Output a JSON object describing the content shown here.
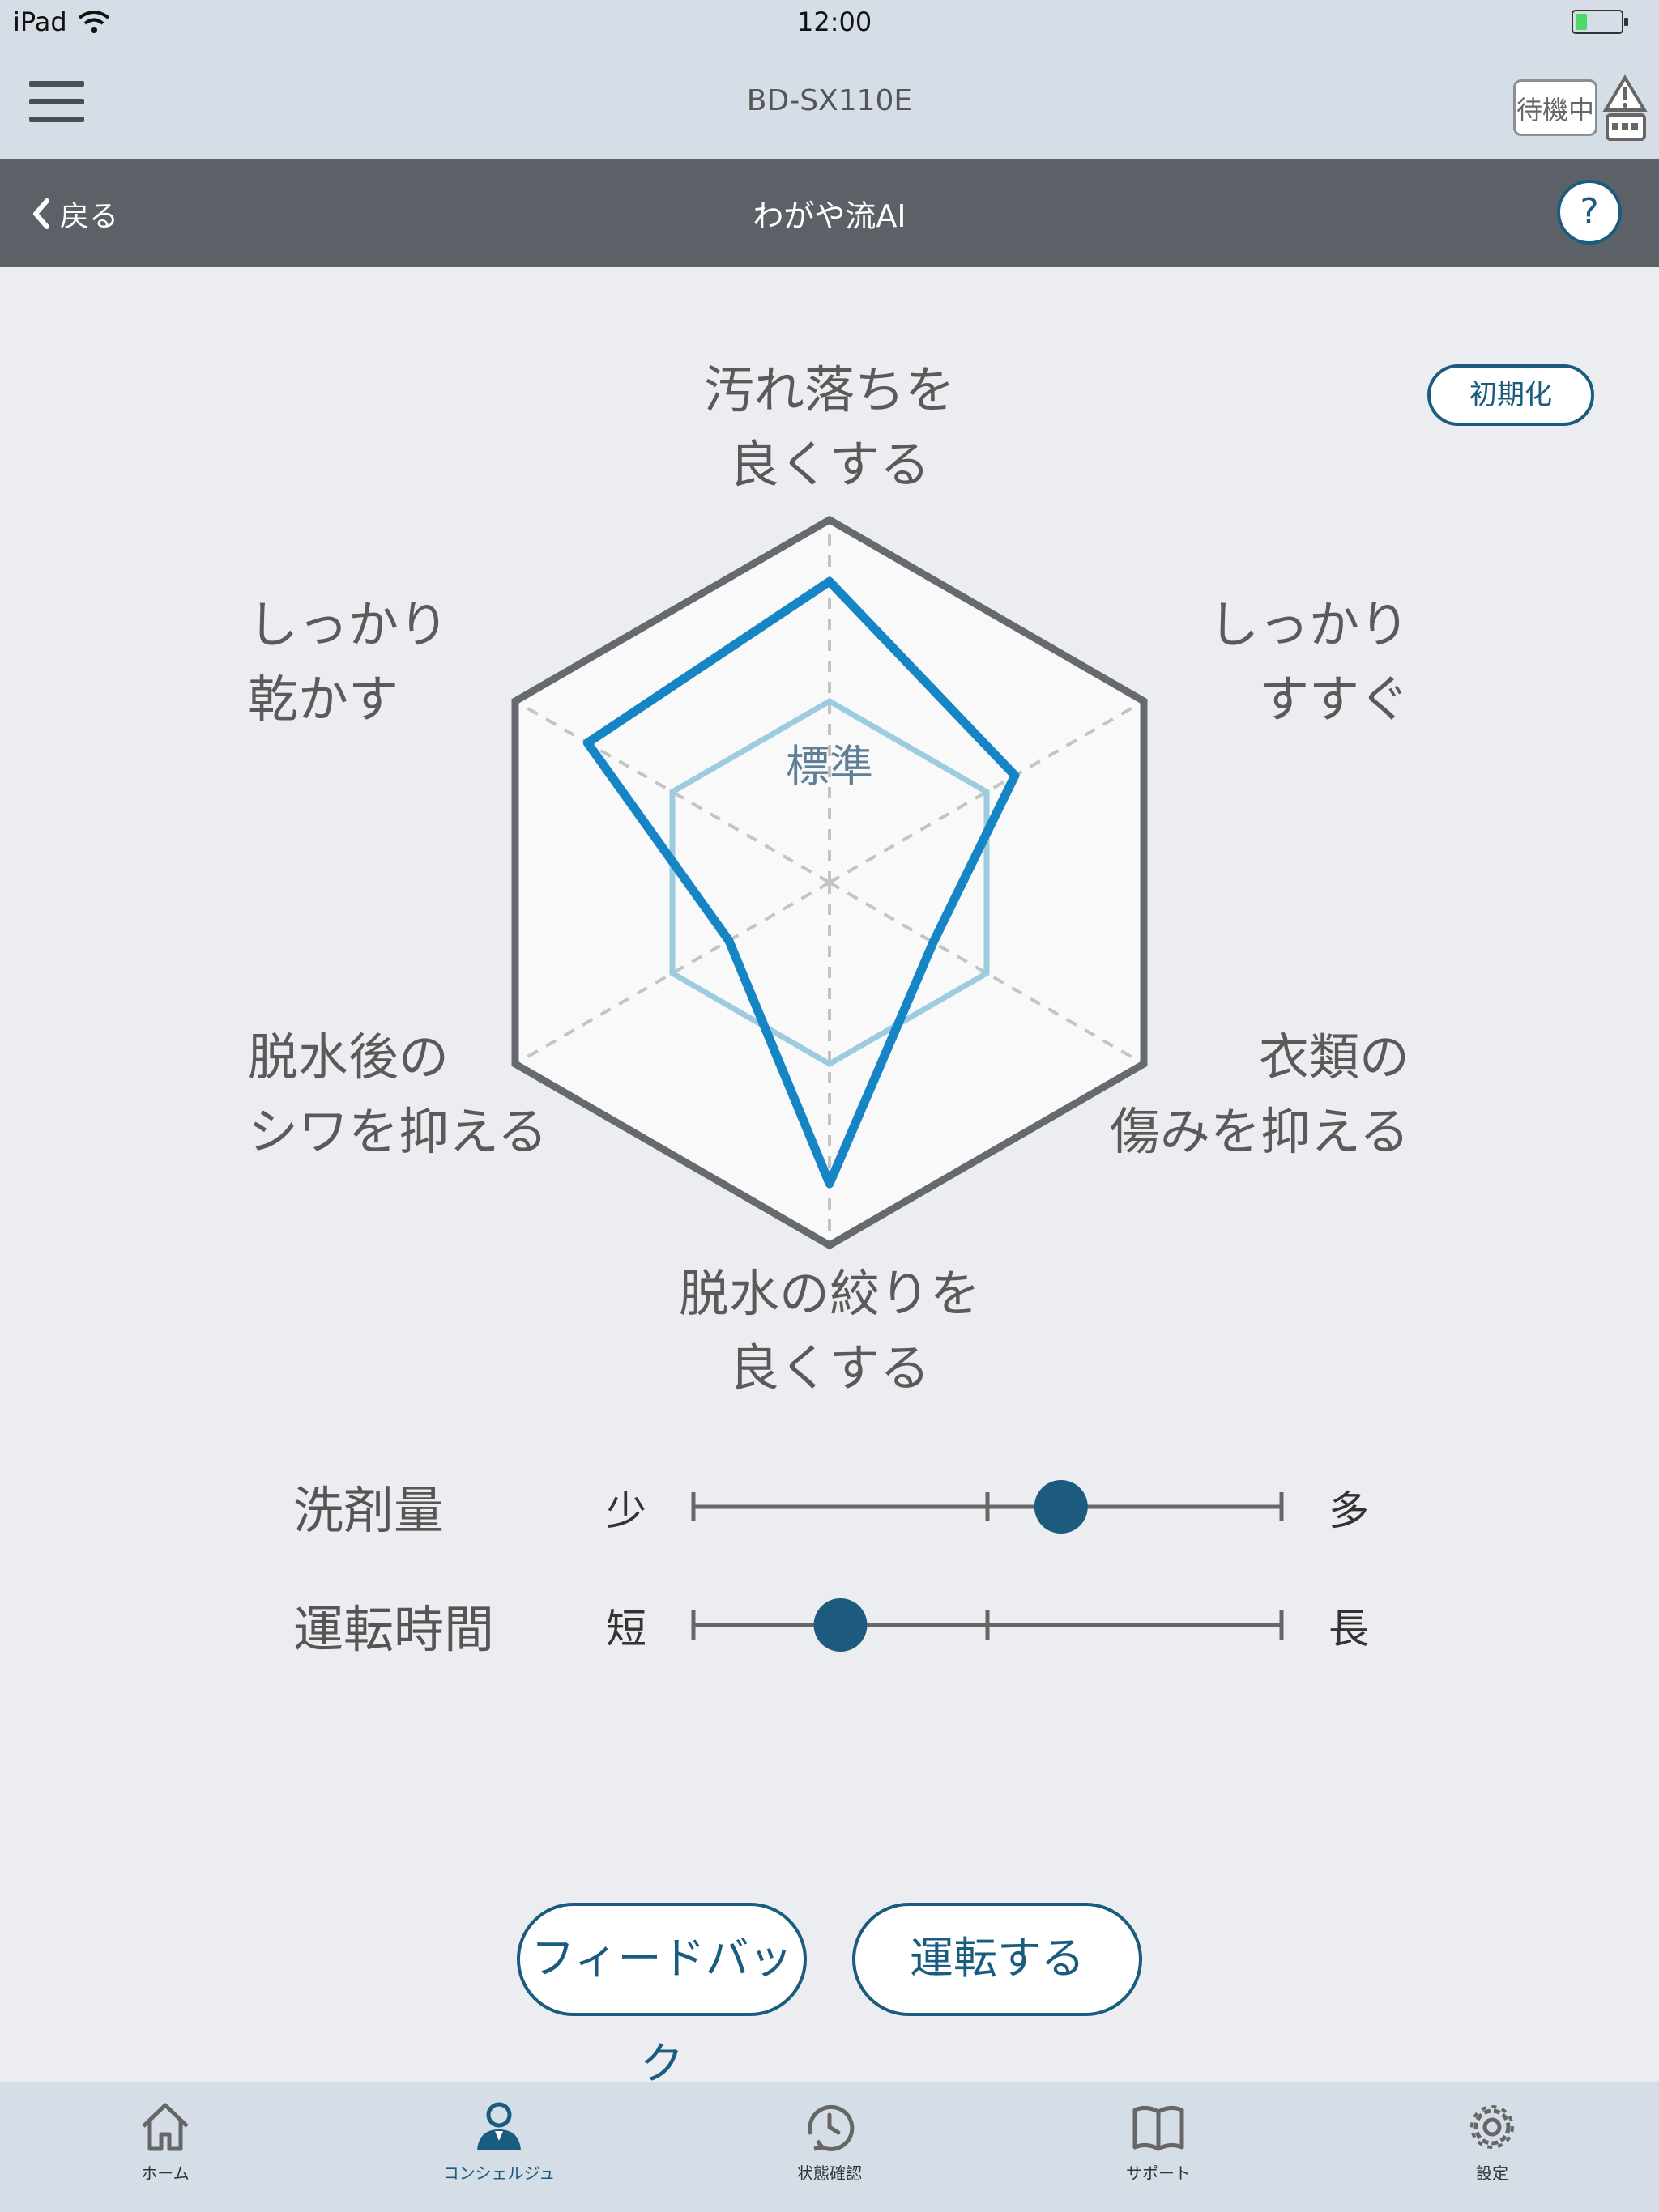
{
  "status_bar": {
    "device": "iPad",
    "time": "12:00"
  },
  "app_header": {
    "model": "BD-SX110E",
    "standby_badge": "待機中"
  },
  "nav": {
    "back_label": "戻る",
    "title": "わがや流AI",
    "help_label": "?"
  },
  "reset_button": "初期化",
  "radar": {
    "center_label": "標準",
    "axes": [
      {
        "id": "dirt",
        "lines": [
          "汚れ落ちを",
          "良くする"
        ],
        "level": 0.83
      },
      {
        "id": "rinse",
        "lines": [
          "しっかり",
          "すすぐ"
        ],
        "level": 0.59
      },
      {
        "id": "fabric",
        "lines": [
          "衣類の",
          "傷みを抑える"
        ],
        "level": 0.33
      },
      {
        "id": "spin",
        "lines": [
          "脱水の絞りを",
          "良くする"
        ],
        "level": 0.83
      },
      {
        "id": "wrinkle",
        "lines": [
          "脱水後の",
          "シワを抑える"
        ],
        "level": 0.32
      },
      {
        "id": "dry",
        "lines": [
          "しっかり",
          "乾かす"
        ],
        "level": 0.77
      }
    ],
    "standard_level": 0.5,
    "colors": {
      "outer": "#666a6e",
      "standard": "#9dcbe0",
      "user": "#1685c6"
    }
  },
  "sliders": [
    {
      "id": "detergent",
      "label": "洗剤量",
      "min_label": "少",
      "max_label": "多",
      "value": 0.625
    },
    {
      "id": "duration",
      "label": "運転時間",
      "min_label": "短",
      "max_label": "長",
      "value": 0.25
    }
  ],
  "buttons": {
    "feedback": "フィードバック",
    "run": "運転する"
  },
  "tabs": [
    {
      "id": "home",
      "label": "ホーム",
      "icon": "home-icon"
    },
    {
      "id": "concierge",
      "label": "コンシェルジュ",
      "icon": "concierge-icon",
      "active": true
    },
    {
      "id": "status",
      "label": "状態確認",
      "icon": "clock-icon"
    },
    {
      "id": "support",
      "label": "サポート",
      "icon": "book-icon"
    },
    {
      "id": "settings",
      "label": "設定",
      "icon": "gear-icon"
    }
  ],
  "accent_color": "#1a5b80"
}
